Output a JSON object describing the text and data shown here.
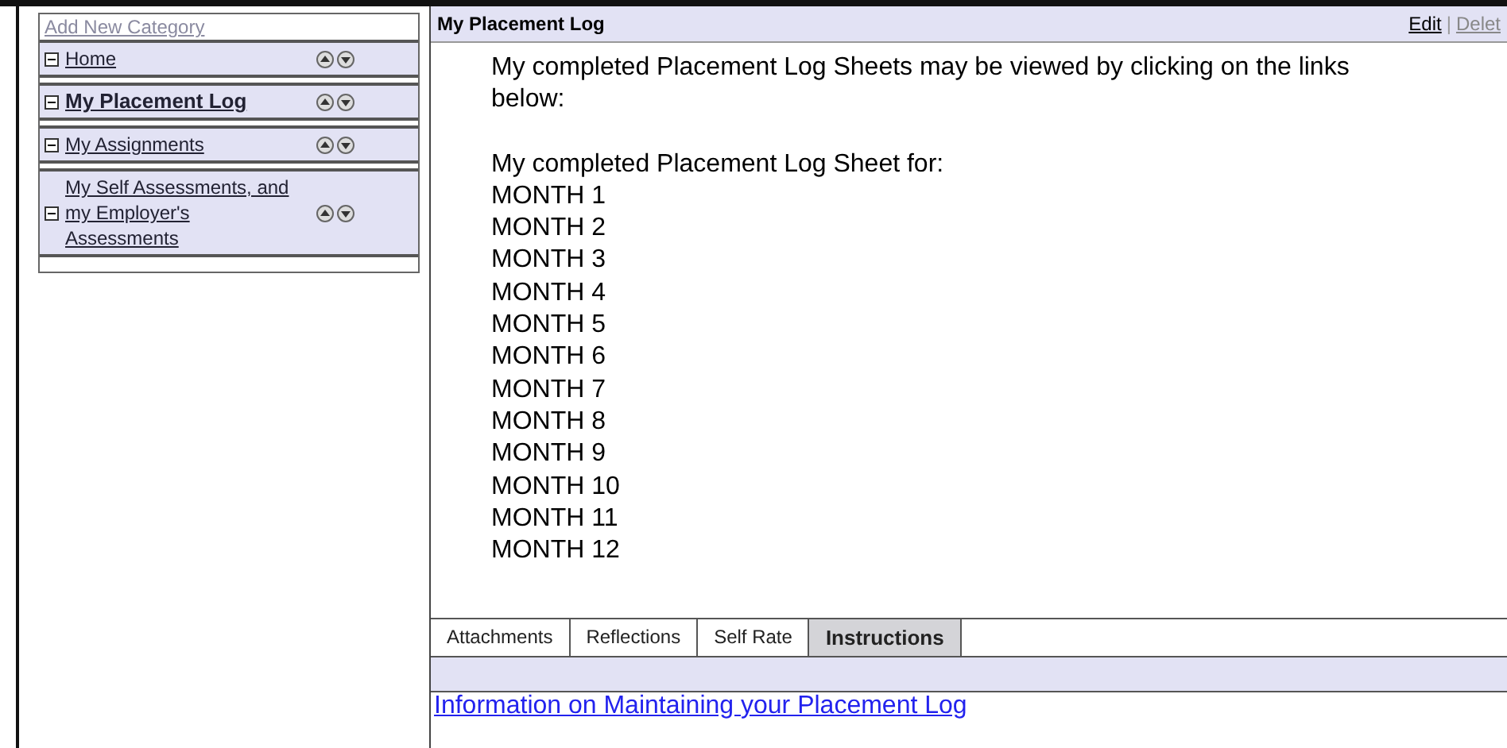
{
  "sidebar": {
    "add_link": "Add New Category",
    "items": [
      {
        "label": "Home",
        "selected": false,
        "expanded": true
      },
      {
        "label": "My Placement Log",
        "selected": true,
        "expanded": true
      },
      {
        "label": "My Assignments",
        "selected": false,
        "expanded": true
      },
      {
        "label": "My Self Assessments, and my Employer's Assessments",
        "selected": false,
        "expanded": true
      }
    ]
  },
  "panel": {
    "title": "My Placement Log",
    "action_separator": "|",
    "actions": [
      {
        "label": "Edit",
        "disabled": false
      },
      {
        "label": "Delet",
        "disabled": true
      }
    ],
    "intro": "My completed Placement Log Sheets may be viewed by clicking on the links below:",
    "list_heading": "My completed Placement Log Sheet for:",
    "months": [
      "MONTH 1",
      "MONTH 2",
      "MONTH 3",
      "MONTH 4",
      "MONTH 5",
      "MONTH 6",
      "MONTH 7",
      "MONTH 8",
      "MONTH 9",
      "MONTH 10",
      "MONTH 11",
      "MONTH 12"
    ]
  },
  "tabs": [
    {
      "label": "Attachments",
      "selected": false
    },
    {
      "label": "Reflections",
      "selected": false
    },
    {
      "label": "Self Rate",
      "selected": false
    },
    {
      "label": "Instructions",
      "selected": true
    }
  ],
  "tab_link": "Information on Maintaining your Placement Log"
}
